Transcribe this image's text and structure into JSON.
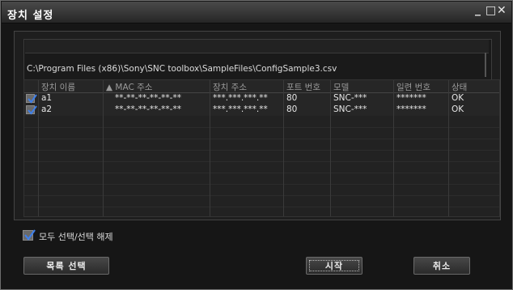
{
  "window": {
    "title": "장치 설정",
    "min": "_",
    "max": "□",
    "close": "✕"
  },
  "file_path": "C:\\Program Files (x86)\\Sony\\SNC toolbox\\SampleFiles\\ConfigSample3.csv",
  "table": {
    "columns": [
      "장치 이름",
      "▲ MAC 주소",
      "장치 주소",
      "포트 번호",
      "모델",
      "일련 번호",
      "상태"
    ],
    "rows": [
      {
        "checked": true,
        "name": "a1",
        "mac": "**-**-**-**-**-**",
        "ip": "***.***.***.**",
        "port": "80",
        "model": "SNC-***",
        "serial": "*******",
        "status": "OK"
      },
      {
        "checked": true,
        "name": "a2",
        "mac": "**-**-**-**-**-**",
        "ip": "***.***.***.**",
        "port": "80",
        "model": "SNC-***",
        "serial": "*******",
        "status": "OK"
      }
    ]
  },
  "select_all": {
    "checked": true,
    "label": "모두 선택/선택 해제"
  },
  "buttons": {
    "list_select": "목록 선택",
    "start": "시작",
    "cancel": "취소"
  }
}
